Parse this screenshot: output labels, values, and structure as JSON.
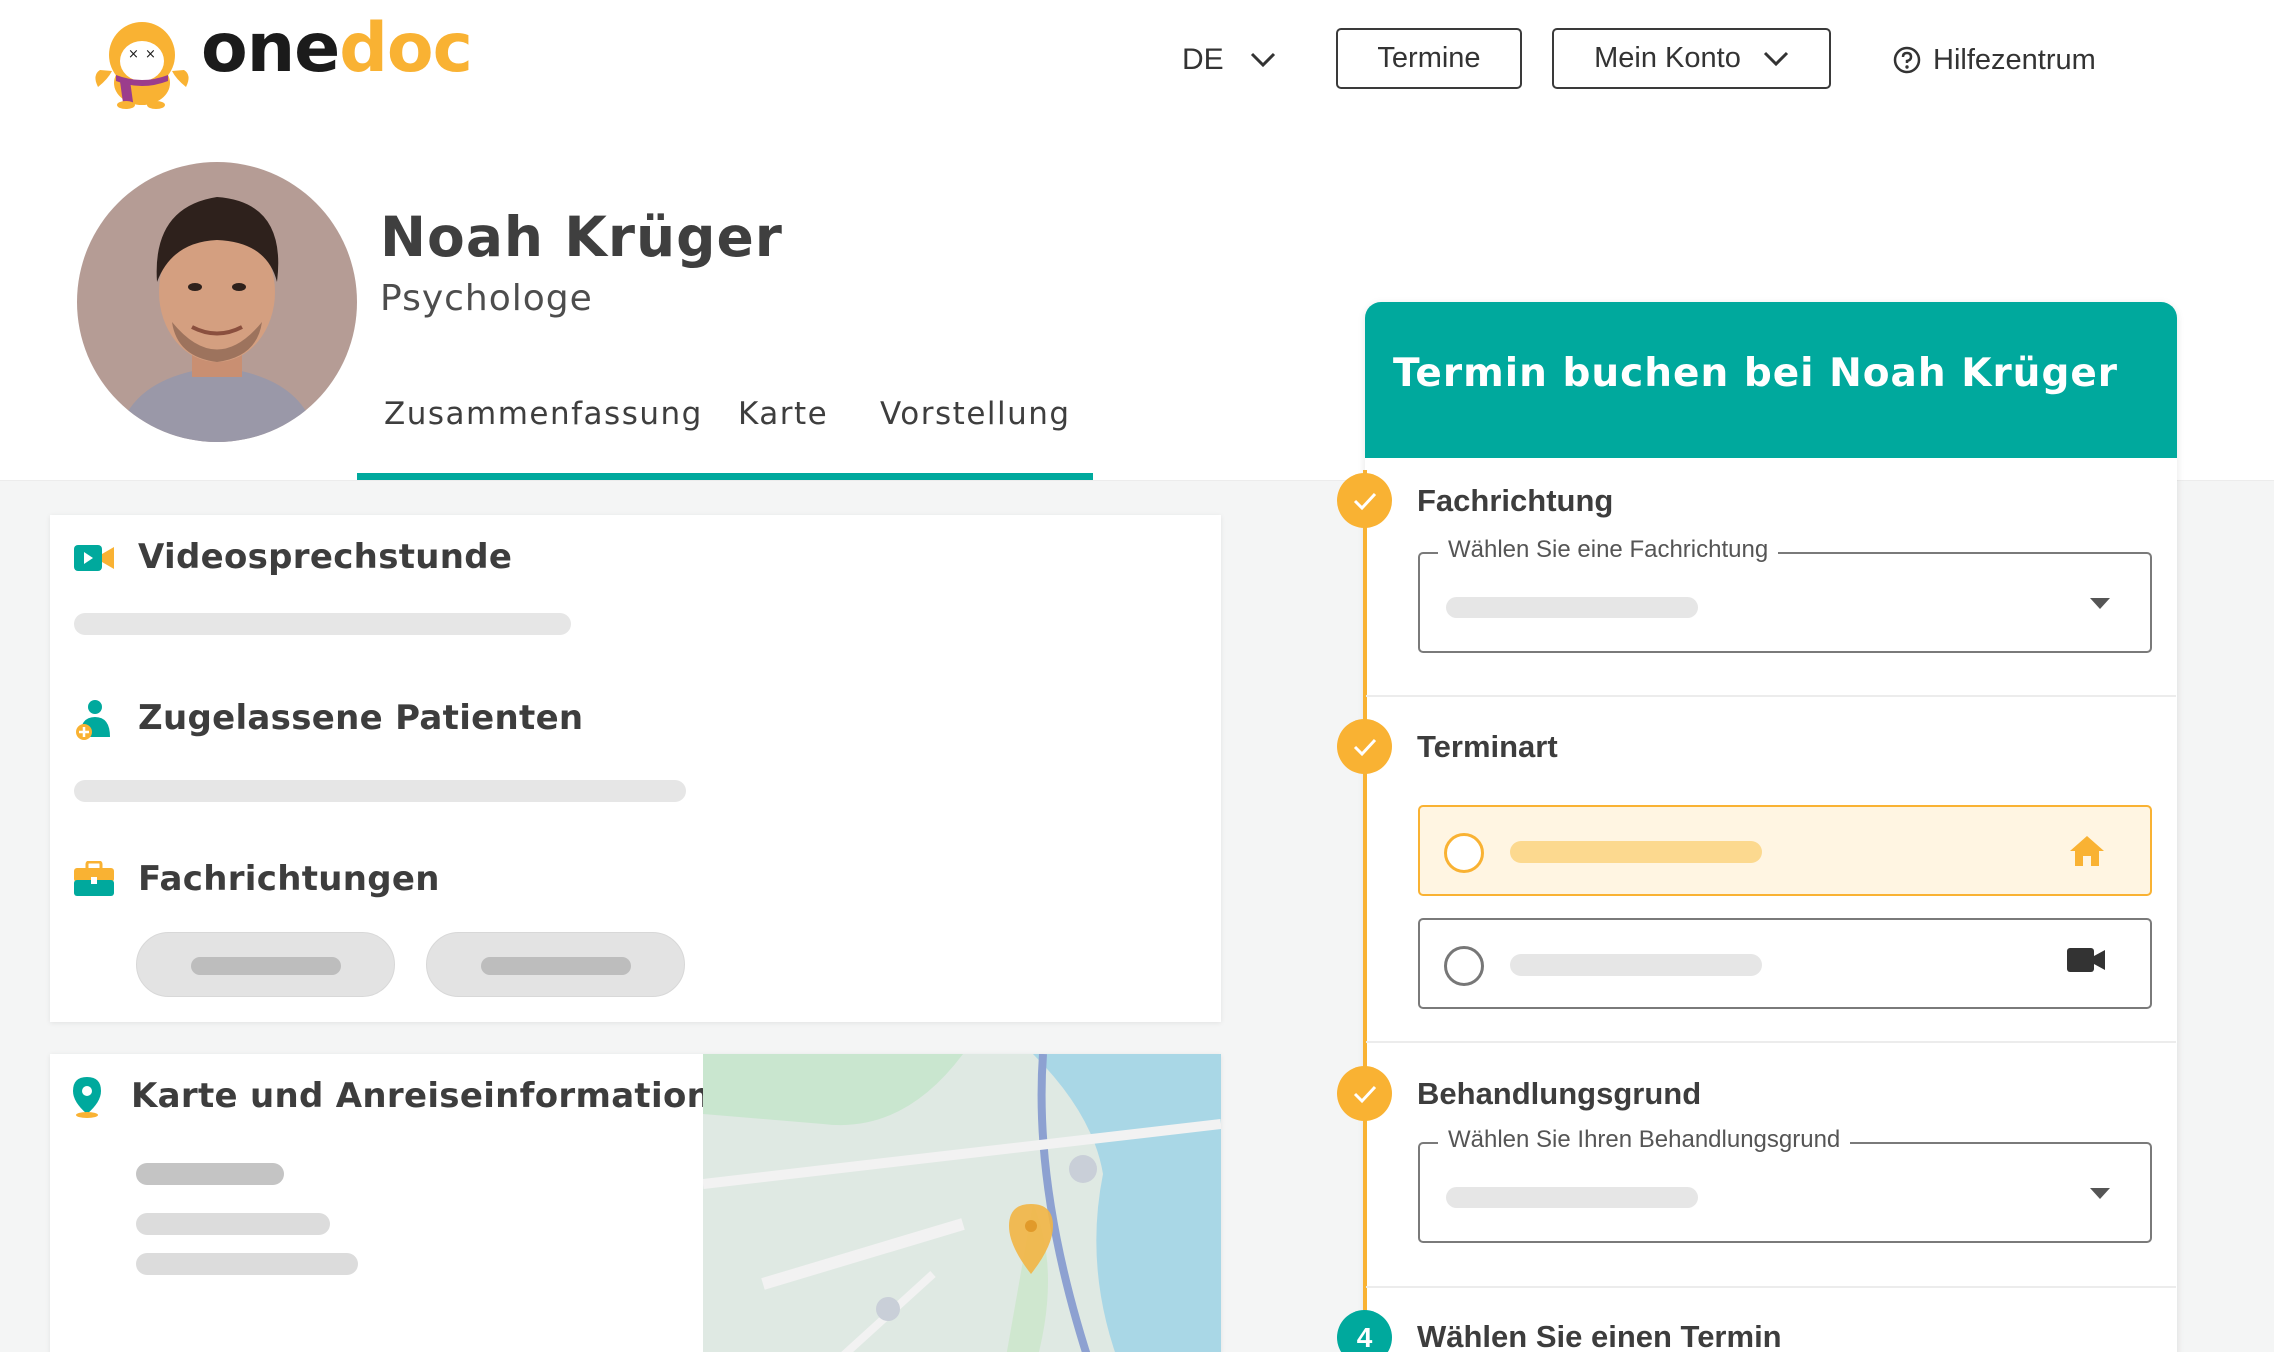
{
  "header": {
    "logo": {
      "part1": "one",
      "part2": "doc"
    },
    "language": "DE",
    "appointments_label": "Termine",
    "account_label": "Mein Konto",
    "help_label": "Hilfezentrum"
  },
  "profile": {
    "name": "Noah Krüger",
    "title": "Psychologe",
    "tabs": [
      {
        "label": "Zusammenfassung",
        "active": true
      },
      {
        "label": "Karte",
        "active": false
      },
      {
        "label": "Vorstellung",
        "active": false
      }
    ]
  },
  "info_card": {
    "sections": [
      {
        "title": "Videosprechstunde",
        "icon": "video-icon"
      },
      {
        "title": "Zugelassene Patienten",
        "icon": "patient-icon"
      },
      {
        "title": "Fachrichtungen",
        "icon": "briefcase-icon"
      }
    ]
  },
  "map_card": {
    "title": "Karte und Anreiseinformationen",
    "icon": "location-pin-icon"
  },
  "booking": {
    "title": "Termin buchen bei Noah Krüger",
    "steps": [
      {
        "title": "Fachrichtung",
        "placeholder": "Wählen Sie eine Fachrichtung",
        "status": "done"
      },
      {
        "title": "Terminart",
        "status": "done",
        "options": [
          {
            "icon": "home-icon",
            "selected": true
          },
          {
            "icon": "video-camera-icon",
            "selected": false
          }
        ]
      },
      {
        "title": "Behandlungsgrund",
        "placeholder": "Wählen Sie Ihren Behandlungsgrund",
        "status": "done"
      },
      {
        "number": "4",
        "title": "Wählen Sie einen Termin",
        "status": "current"
      }
    ]
  },
  "colors": {
    "brand_teal": "#00a99d",
    "brand_yellow": "#f9b233",
    "text_dark": "#3d3d3d"
  }
}
